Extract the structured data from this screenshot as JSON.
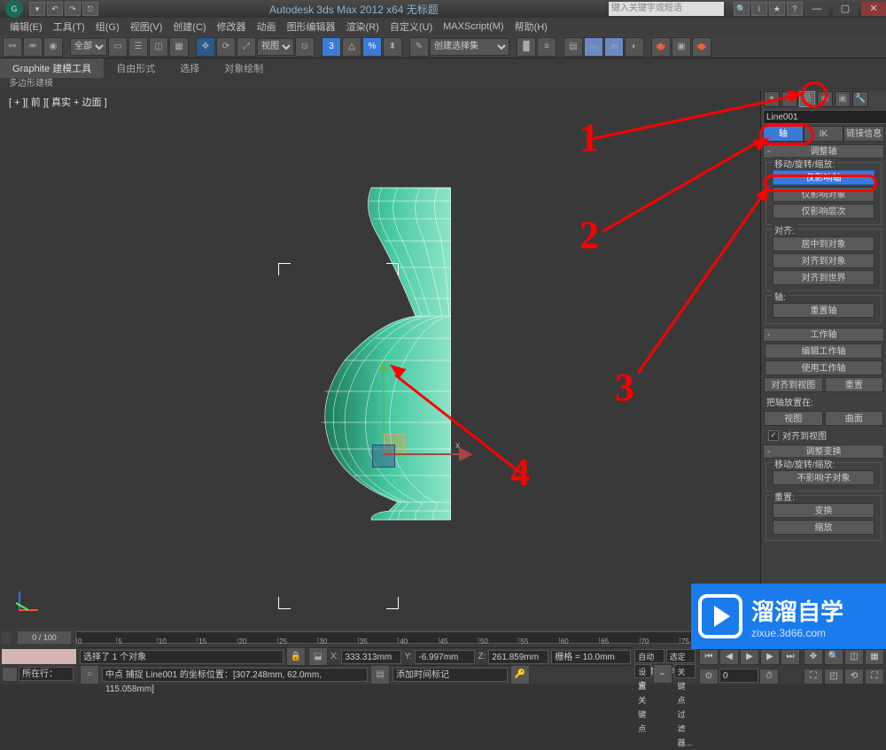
{
  "title_bar": {
    "app_title": "Autodesk 3ds Max 2012 x64   无标题",
    "search_placeholder": "键入关键字或短语"
  },
  "menu": {
    "edit": "编辑(E)",
    "tools": "工具(T)",
    "group": "组(G)",
    "views": "视图(V)",
    "create": "创建(C)",
    "modifiers": "修改器",
    "animation": "动画",
    "graph": "图形编辑器",
    "render": "渲染(R)",
    "customize": "自定义(U)",
    "maxscript": "MAXScript(M)",
    "help": "帮助(H)"
  },
  "toolbar": {
    "set_all": "全部",
    "view_label": "视图",
    "selset": "创建选择集"
  },
  "ribbon": {
    "tab1": "Graphite 建模工具",
    "tab2": "自由形式",
    "tab3": "选择",
    "tab4": "对象绘制",
    "sub": "多边形建模"
  },
  "viewport": {
    "label": "[ + ][ 前 ][ 真实 + 边面 ]"
  },
  "right_panel": {
    "object_name": "Line001",
    "tab_pivot": "轴",
    "tab_ik": "IK",
    "tab_link": "链接信息",
    "rollout_adjust": "调整轴",
    "group_move": "移动/旋转/缩放:",
    "btn_affect_pivot": "仅影响轴",
    "btn_affect_object": "仅影响对象",
    "btn_affect_hier": "仅影响层次",
    "group_align": "对齐:",
    "btn_center": "居中到对象",
    "btn_align_obj": "对齐到对象",
    "btn_align_world": "对齐到世界",
    "group_axis": "轴:",
    "btn_reset_axis": "重置轴",
    "rollout_working": "工作轴",
    "btn_edit_wp": "编辑工作轴",
    "btn_use_wp": "使用工作轴",
    "btn_align_view": "对齐到视图",
    "btn_reset": "重置",
    "lbl_place": "把轴放置在:",
    "btn_view": "视图",
    "btn_surface": "曲面",
    "chk_align_view": "对齐到视图",
    "rollout_xform": "调整变换",
    "group_move2": "移动/旋转/缩放:",
    "btn_dont_affect": "不影响子对象",
    "group_reset": "重置:",
    "btn_xform": "变换",
    "btn_scale": "缩放"
  },
  "time": {
    "slider": "0 / 100"
  },
  "status": {
    "sel": "选择了 1 个对象",
    "x": "X:",
    "xval": "333.313mm",
    "y": "Y:",
    "yval": "-6.997mm",
    "z": "Z:",
    "zval": "261.859mm",
    "grid": "栅格 = 10.0mm",
    "snap": "中点  捕捉  Line001 的坐标位置：",
    "coords": "[307.248mm, 62.0mm, 115.058mm]",
    "addtime": "添加时间标记",
    "autokey": "自动关键点",
    "selkey": "选定对象",
    "setkey": "设置关键点",
    "keyfilter": "关键点过滤器...",
    "now": "所在行："
  },
  "annotations": {
    "n1": "1",
    "n2": "2",
    "n3": "3",
    "n4": "4"
  },
  "watermark": {
    "big": "溜溜自学",
    "small": "zixue.3d66.com"
  }
}
